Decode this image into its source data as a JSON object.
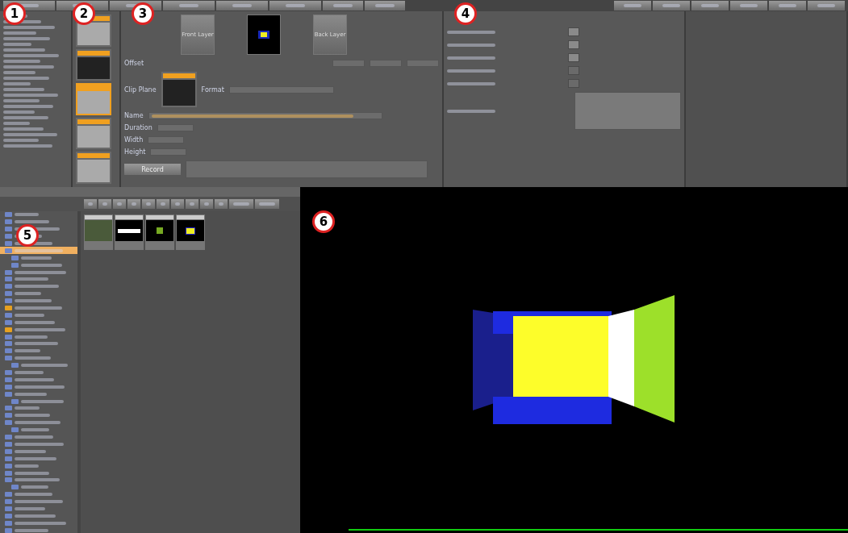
{
  "callouts": [
    {
      "label": "1"
    },
    {
      "label": "2"
    },
    {
      "label": "3"
    },
    {
      "label": "4"
    },
    {
      "label": "5"
    },
    {
      "label": "6"
    }
  ],
  "editor": {
    "front_label": "Front Layer",
    "back_label": "Back Layer",
    "offset_label": "Offset",
    "clip_label": "Clip Plane",
    "format_label": "Format",
    "name_label": "Name",
    "duration_label": "Duration",
    "width_label": "Width",
    "height_label": "Height",
    "record_button": "Record"
  },
  "thumbs": [
    {
      "kind": "sequence",
      "selected": false
    },
    {
      "kind": "media",
      "selected": false
    },
    {
      "kind": "sequence",
      "selected": true
    },
    {
      "kind": "sequence",
      "selected": false
    },
    {
      "kind": "sequence",
      "selected": false
    }
  ],
  "props": {
    "toggles": [
      {
        "on": true
      },
      {
        "on": true
      },
      {
        "on": true
      },
      {
        "on": false
      },
      {
        "on": false
      }
    ]
  },
  "tree": [
    {
      "kind": "folder",
      "selected": false
    },
    {
      "kind": "folder",
      "selected": false
    },
    {
      "kind": "folder",
      "selected": false
    },
    {
      "kind": "folder",
      "selected": false
    },
    {
      "kind": "folder",
      "selected": false
    },
    {
      "kind": "folder",
      "selected": true
    },
    {
      "kind": "sub",
      "selected": false
    },
    {
      "kind": "sub",
      "selected": false
    },
    {
      "kind": "folder",
      "selected": false
    },
    {
      "kind": "folder",
      "selected": false
    },
    {
      "kind": "folder",
      "selected": false
    },
    {
      "kind": "folder",
      "selected": false
    },
    {
      "kind": "folder",
      "selected": false
    },
    {
      "kind": "yellow",
      "selected": false
    },
    {
      "kind": "folder",
      "selected": false
    },
    {
      "kind": "folder",
      "selected": false
    },
    {
      "kind": "yellow",
      "selected": false
    },
    {
      "kind": "folder",
      "selected": false
    },
    {
      "kind": "folder",
      "selected": false
    },
    {
      "kind": "folder",
      "selected": false
    },
    {
      "kind": "folder",
      "selected": false
    },
    {
      "kind": "sub",
      "selected": false
    },
    {
      "kind": "folder",
      "selected": false
    },
    {
      "kind": "folder",
      "selected": false
    },
    {
      "kind": "folder",
      "selected": false
    },
    {
      "kind": "folder",
      "selected": false
    },
    {
      "kind": "sub",
      "selected": false
    },
    {
      "kind": "folder",
      "selected": false
    },
    {
      "kind": "folder",
      "selected": false
    },
    {
      "kind": "folder",
      "selected": false
    },
    {
      "kind": "sub",
      "selected": false
    },
    {
      "kind": "folder",
      "selected": false
    },
    {
      "kind": "folder",
      "selected": false
    },
    {
      "kind": "folder",
      "selected": false
    },
    {
      "kind": "folder",
      "selected": false
    },
    {
      "kind": "folder",
      "selected": false
    },
    {
      "kind": "folder",
      "selected": false
    },
    {
      "kind": "folder",
      "selected": false
    },
    {
      "kind": "sub",
      "selected": false
    },
    {
      "kind": "folder",
      "selected": false
    },
    {
      "kind": "folder",
      "selected": false
    },
    {
      "kind": "folder",
      "selected": false
    },
    {
      "kind": "folder",
      "selected": false
    },
    {
      "kind": "folder",
      "selected": false
    },
    {
      "kind": "folder",
      "selected": false
    }
  ],
  "assets": [
    {
      "kind": "map"
    },
    {
      "kind": "bar"
    },
    {
      "kind": "square"
    },
    {
      "kind": "box"
    }
  ]
}
